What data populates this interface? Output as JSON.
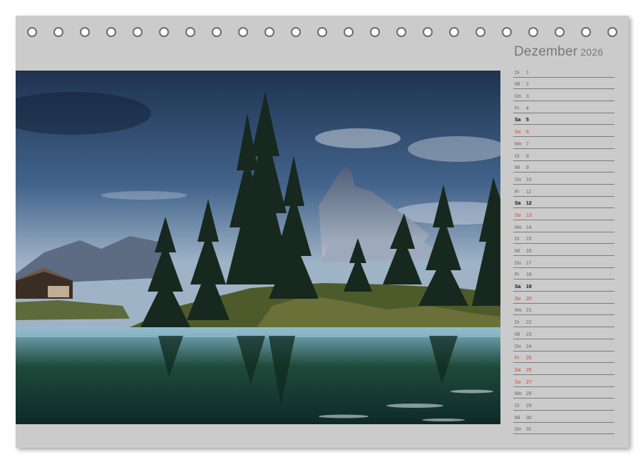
{
  "calendar": {
    "month": "Dezember",
    "year": "2026",
    "days": [
      {
        "dow": "Di",
        "num": "1",
        "type": "normal"
      },
      {
        "dow": "Mi",
        "num": "2",
        "type": "normal"
      },
      {
        "dow": "Do",
        "num": "3",
        "type": "normal"
      },
      {
        "dow": "Fr",
        "num": "4",
        "type": "normal"
      },
      {
        "dow": "Sa",
        "num": "5",
        "type": "saturday"
      },
      {
        "dow": "So",
        "num": "6",
        "type": "holiday"
      },
      {
        "dow": "Mo",
        "num": "7",
        "type": "normal"
      },
      {
        "dow": "Di",
        "num": "8",
        "type": "normal"
      },
      {
        "dow": "Mi",
        "num": "9",
        "type": "normal"
      },
      {
        "dow": "Do",
        "num": "10",
        "type": "normal"
      },
      {
        "dow": "Fr",
        "num": "11",
        "type": "normal"
      },
      {
        "dow": "Sa",
        "num": "12",
        "type": "saturday"
      },
      {
        "dow": "So",
        "num": "13",
        "type": "holiday"
      },
      {
        "dow": "Mo",
        "num": "14",
        "type": "normal"
      },
      {
        "dow": "Di",
        "num": "15",
        "type": "normal"
      },
      {
        "dow": "Mi",
        "num": "16",
        "type": "normal"
      },
      {
        "dow": "Do",
        "num": "17",
        "type": "normal"
      },
      {
        "dow": "Fr",
        "num": "18",
        "type": "normal"
      },
      {
        "dow": "Sa",
        "num": "19",
        "type": "saturday"
      },
      {
        "dow": "So",
        "num": "20",
        "type": "holiday"
      },
      {
        "dow": "Mo",
        "num": "21",
        "type": "normal"
      },
      {
        "dow": "Di",
        "num": "22",
        "type": "normal"
      },
      {
        "dow": "Mi",
        "num": "23",
        "type": "normal"
      },
      {
        "dow": "Do",
        "num": "24",
        "type": "normal"
      },
      {
        "dow": "Fr",
        "num": "25",
        "type": "holiday"
      },
      {
        "dow": "Sa",
        "num": "26",
        "type": "holiday"
      },
      {
        "dow": "So",
        "num": "27",
        "type": "holiday"
      },
      {
        "dow": "Mo",
        "num": "28",
        "type": "normal"
      },
      {
        "dow": "Di",
        "num": "29",
        "type": "normal"
      },
      {
        "dow": "Mi",
        "num": "30",
        "type": "normal"
      },
      {
        "dow": "Do",
        "num": "31",
        "type": "normal"
      }
    ]
  },
  "colors": {
    "page": "#cbcbcb",
    "holiday": "#e03a2e",
    "text": "#666666"
  },
  "binding": {
    "ring_count": 23
  }
}
